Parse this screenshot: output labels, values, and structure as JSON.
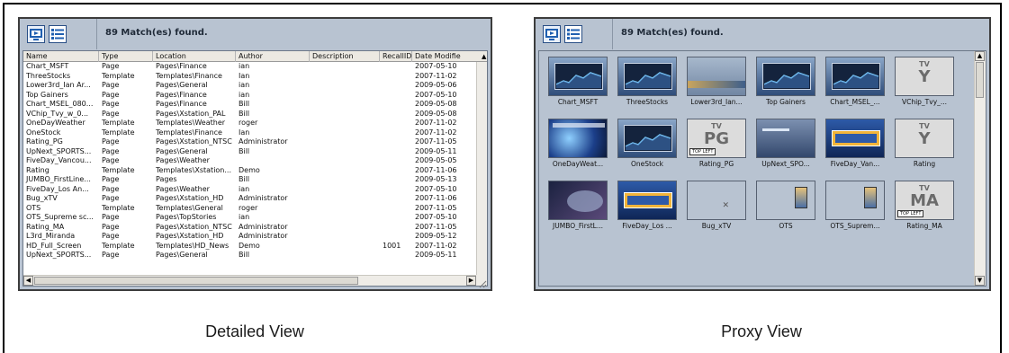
{
  "detailed": {
    "match_text": "89 Match(es) found.",
    "columns": [
      "Name",
      "Type",
      "Location",
      "Author",
      "Description",
      "RecallID",
      "Date Modifie"
    ],
    "rows": [
      [
        "Chart_MSFT",
        "Page",
        "Pages\\Finance",
        "ian",
        "",
        "",
        "2007-05-10"
      ],
      [
        "ThreeStocks",
        "Template",
        "Templates\\Finance",
        "Ian",
        "",
        "",
        "2007-11-02"
      ],
      [
        "Lower3rd_Ian Ar...",
        "Page",
        "Pages\\General",
        "ian",
        "",
        "",
        "2009-05-06"
      ],
      [
        "Top Gainers",
        "Page",
        "Pages\\Finance",
        "ian",
        "",
        "",
        "2007-05-10"
      ],
      [
        "Chart_MSEL_080...",
        "Page",
        "Pages\\Finance",
        "Bill",
        "",
        "",
        "2009-05-08"
      ],
      [
        "VChip_Tvy_w_0...",
        "Page",
        "Pages\\Xstation_PAL",
        "Bill",
        "",
        "",
        "2009-05-08"
      ],
      [
        "OneDayWeather",
        "Template",
        "Templates\\Weather",
        "roger",
        "",
        "",
        "2007-11-02"
      ],
      [
        "OneStock",
        "Template",
        "Templates\\Finance",
        "Ian",
        "",
        "",
        "2007-11-02"
      ],
      [
        "Rating_PG",
        "Page",
        "Pages\\Xstation_NTSC",
        "Administrator",
        "",
        "",
        "2007-11-05"
      ],
      [
        "UpNext_SPORTS...",
        "Page",
        "Pages\\General",
        "Bill",
        "",
        "",
        "2009-05-11"
      ],
      [
        "FiveDay_Vancou...",
        "Page",
        "Pages\\Weather",
        "",
        "",
        "",
        "2009-05-05"
      ],
      [
        "Rating",
        "Template",
        "Templates\\Xstation...",
        "Demo",
        "",
        "",
        "2007-11-06"
      ],
      [
        "JUMBO_FirstLine...",
        "Page",
        "Pages",
        "Bill",
        "",
        "",
        "2009-05-13"
      ],
      [
        "FiveDay_Los An...",
        "Page",
        "Pages\\Weather",
        "ian",
        "",
        "",
        "2007-05-10"
      ],
      [
        "Bug_xTV",
        "Page",
        "Pages\\Xstation_HD",
        "Administrator",
        "",
        "",
        "2007-11-06"
      ],
      [
        "OTS",
        "Template",
        "Templates\\General",
        "roger",
        "",
        "",
        "2007-11-05"
      ],
      [
        "OTS_Supreme sc...",
        "Page",
        "Pages\\TopStories",
        "ian",
        "",
        "",
        "2007-05-10"
      ],
      [
        "Rating_MA",
        "Page",
        "Pages\\Xstation_NTSC",
        "Administrator",
        "",
        "",
        "2007-11-05"
      ],
      [
        "L3rd_Miranda",
        "Page",
        "Pages\\Xstation_HD",
        "Administrator",
        "",
        "",
        "2009-05-12"
      ],
      [
        "HD_Full_Screen",
        "Template",
        "Templates\\HD_News",
        "Demo",
        "",
        "1001",
        "2007-11-02"
      ],
      [
        "UpNext_SPORTS...",
        "Page",
        "Pages\\General",
        "Bill",
        "",
        "",
        "2009-05-11"
      ]
    ],
    "caption": "Detailed View"
  },
  "proxy": {
    "match_text": "89 Match(es) found.",
    "tiles": [
      {
        "label": "Chart_MSFT",
        "kind": "chart"
      },
      {
        "label": "ThreeStocks",
        "kind": "chart"
      },
      {
        "label": "Lower3rd_Ian...",
        "kind": "lower3rd"
      },
      {
        "label": "Top Gainers",
        "kind": "chart"
      },
      {
        "label": "Chart_MSEL_...",
        "kind": "chart"
      },
      {
        "label": "VChip_Tvy_...",
        "kind": "rating",
        "rating_top": "TV",
        "rating_main": "Y"
      },
      {
        "label": "OneDayWeat...",
        "kind": "weather"
      },
      {
        "label": "OneStock",
        "kind": "chart"
      },
      {
        "label": "Rating_PG",
        "kind": "rating",
        "rating_top": "TV",
        "rating_main": "PG",
        "corner": "TOP LEFT"
      },
      {
        "label": "UpNext_SPO...",
        "kind": "upnext"
      },
      {
        "label": "FiveDay_Van...",
        "kind": "fiveday"
      },
      {
        "label": "Rating",
        "kind": "rating",
        "rating_top": "TV",
        "rating_main": "Y"
      },
      {
        "label": "JUMBO_FirstL...",
        "kind": "jumbo"
      },
      {
        "label": "FiveDay_Los ...",
        "kind": "fiveday"
      },
      {
        "label": "Bug_xTV",
        "kind": "bug"
      },
      {
        "label": "OTS",
        "kind": "ots"
      },
      {
        "label": "OTS_Suprem...",
        "kind": "ots"
      },
      {
        "label": "Rating_MA",
        "kind": "rating",
        "rating_top": "TV",
        "rating_main": "MA",
        "corner": "TOP LEFT"
      }
    ],
    "caption": "Proxy View"
  },
  "icons": {
    "view_proxy": "monitor-icon",
    "view_list": "list-icon"
  },
  "colors": {
    "panel_bg": "#b8c3d1",
    "icon_blue": "#1f5fb0"
  }
}
